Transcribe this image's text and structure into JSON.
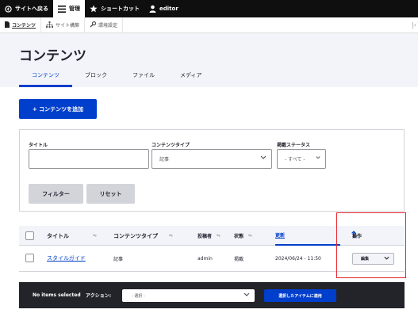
{
  "toolbar": {
    "back_label": "サイトへ戻る",
    "manage_label": "管理",
    "shortcuts_label": "ショートカット",
    "user_label": "editor"
  },
  "tray": {
    "content_label": "コンテンツ",
    "structure_label": "サイト構築",
    "config_label": "環境設定",
    "end_glyph": "|‹"
  },
  "header": {
    "title": "コンテンツ",
    "tabs": [
      {
        "label": "コンテンツ"
      },
      {
        "label": "ブロック"
      },
      {
        "label": "ファイル"
      },
      {
        "label": "メディア"
      }
    ]
  },
  "add_button_label": "+ コンテンツを追加",
  "filters": {
    "title_label": "タイトル",
    "title_value": "",
    "type_label": "コンテンツタイプ",
    "type_value": "記事",
    "status_label": "掲載ステータス",
    "status_value": "- すべて -",
    "filter_button": "フィルター",
    "reset_button": "リセット"
  },
  "table": {
    "headers": {
      "title": "タイトル",
      "type": "コンテンツタイプ",
      "author": "投稿者",
      "status": "状態",
      "updated": "更新",
      "operations": "操作"
    },
    "rows": [
      {
        "title": "スタイルガイド",
        "type": "記事",
        "author": "admin",
        "status": "掲載",
        "updated": "2024/06/24 - 11:50",
        "operation": "編集"
      }
    ]
  },
  "bulk": {
    "selected_label": "No items selected",
    "action_label": "アクション:",
    "action_value": "- 選択 -",
    "apply_label": "選択したアイテムに適用"
  },
  "colors": {
    "accent": "#003ecc",
    "highlight": "#e8212b",
    "toolbar": "#0f0f0f"
  }
}
